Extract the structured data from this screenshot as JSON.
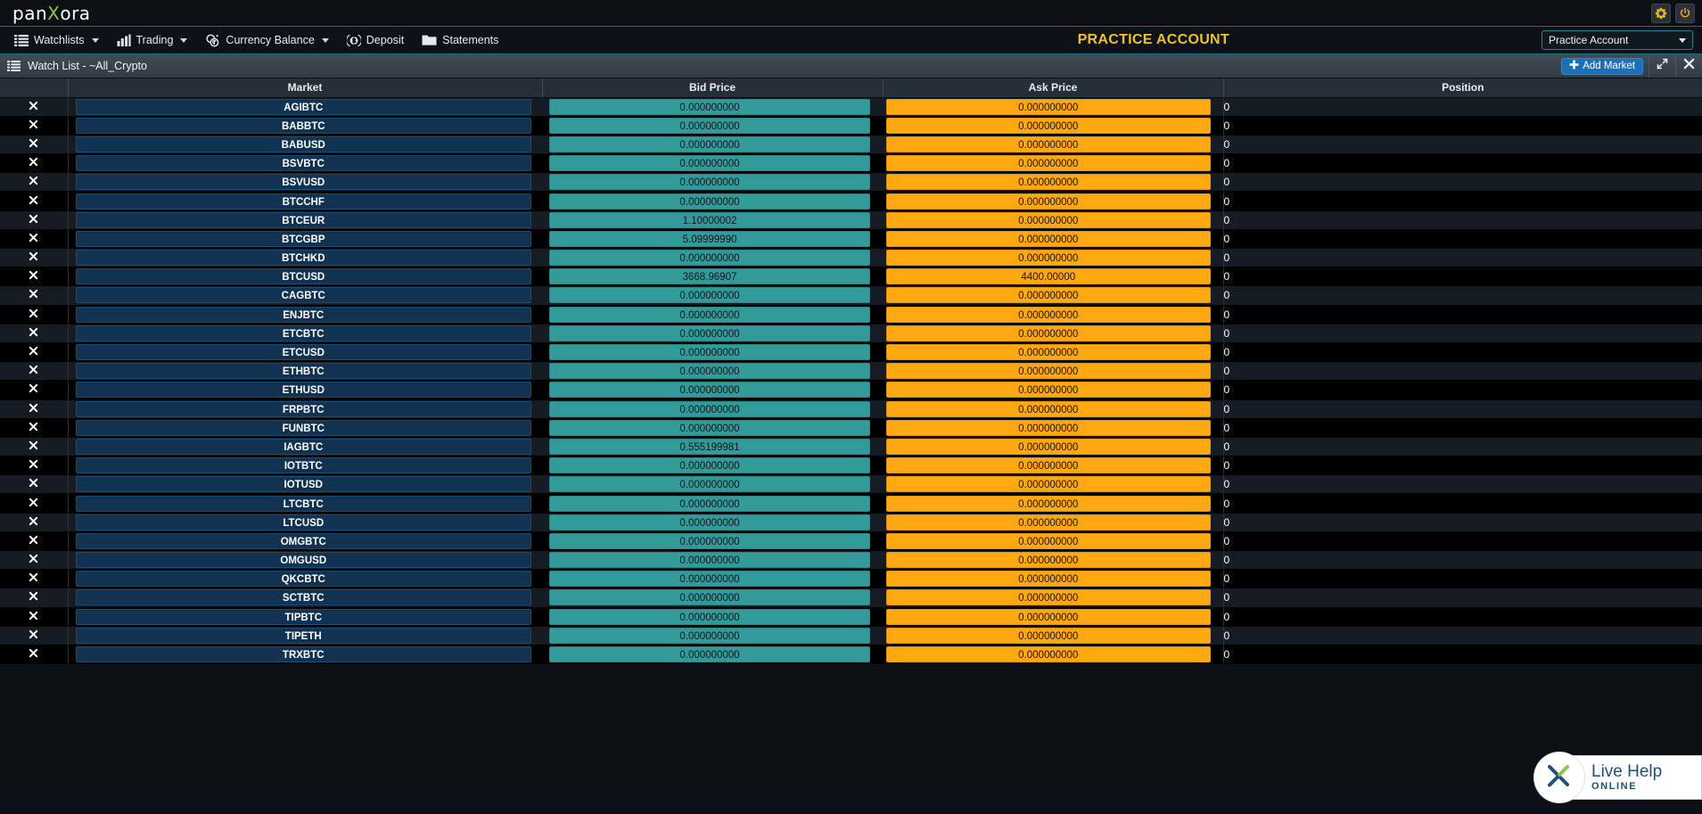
{
  "brand": {
    "name_pre": "pan",
    "name_x": "X",
    "name_post": "ora"
  },
  "topbar": {
    "settings_icon": "gear-icon",
    "power_icon": "power-icon"
  },
  "menubar": {
    "items": [
      {
        "label": "Watchlists",
        "icon": "list-icon",
        "caret": true
      },
      {
        "label": "Trading",
        "icon": "bar-chart-icon",
        "caret": true
      },
      {
        "label": "Currency Balance",
        "icon": "coins-icon",
        "caret": true
      },
      {
        "label": "Deposit",
        "icon": "bitcoin-icon",
        "caret": false
      },
      {
        "label": "Statements",
        "icon": "folder-icon",
        "caret": false
      }
    ],
    "practice_label": "PRACTICE ACCOUNT",
    "account_select": {
      "value": "Practice Account",
      "caret_icon": "chevron-down-icon"
    }
  },
  "panel": {
    "title": "Watch List - ~All_Crypto",
    "title_icon": "list-icon",
    "add_market_label": "Add Market",
    "add_market_icon": "plus-icon",
    "expand_icon": "expand-icon",
    "close_icon": "close-icon"
  },
  "table": {
    "columns": [
      "",
      "Market",
      "Bid Price",
      "Ask Price",
      "Position"
    ],
    "remove_icon": "close-icon",
    "rows": [
      {
        "market": "AGIBTC",
        "bid": "0.000000000",
        "ask": "0.000000000",
        "position": "0"
      },
      {
        "market": "BABBTC",
        "bid": "0.000000000",
        "ask": "0.000000000",
        "position": "0"
      },
      {
        "market": "BABUSD",
        "bid": "0.000000000",
        "ask": "0.000000000",
        "position": "0"
      },
      {
        "market": "BSVBTC",
        "bid": "0.000000000",
        "ask": "0.000000000",
        "position": "0"
      },
      {
        "market": "BSVUSD",
        "bid": "0.000000000",
        "ask": "0.000000000",
        "position": "0"
      },
      {
        "market": "BTCCHF",
        "bid": "0.000000000",
        "ask": "0.000000000",
        "position": "0"
      },
      {
        "market": "BTCEUR",
        "bid": "1.10000002",
        "ask": "0.000000000",
        "position": "0"
      },
      {
        "market": "BTCGBP",
        "bid": "5.09999990",
        "ask": "0.000000000",
        "position": "0"
      },
      {
        "market": "BTCHKD",
        "bid": "0.000000000",
        "ask": "0.000000000",
        "position": "0"
      },
      {
        "market": "BTCUSD",
        "bid": "3668.96907",
        "ask": "4400.00000",
        "position": "0"
      },
      {
        "market": "CAGBTC",
        "bid": "0.000000000",
        "ask": "0.000000000",
        "position": "0"
      },
      {
        "market": "ENJBTC",
        "bid": "0.000000000",
        "ask": "0.000000000",
        "position": "0"
      },
      {
        "market": "ETCBTC",
        "bid": "0.000000000",
        "ask": "0.000000000",
        "position": "0"
      },
      {
        "market": "ETCUSD",
        "bid": "0.000000000",
        "ask": "0.000000000",
        "position": "0"
      },
      {
        "market": "ETHBTC",
        "bid": "0.000000000",
        "ask": "0.000000000",
        "position": "0"
      },
      {
        "market": "ETHUSD",
        "bid": "0.000000000",
        "ask": "0.000000000",
        "position": "0"
      },
      {
        "market": "FRPBTC",
        "bid": "0.000000000",
        "ask": "0.000000000",
        "position": "0"
      },
      {
        "market": "FUNBTC",
        "bid": "0.000000000",
        "ask": "0.000000000",
        "position": "0"
      },
      {
        "market": "IAGBTC",
        "bid": "0.555199981",
        "ask": "0.000000000",
        "position": "0"
      },
      {
        "market": "IOTBTC",
        "bid": "0.000000000",
        "ask": "0.000000000",
        "position": "0"
      },
      {
        "market": "IOTUSD",
        "bid": "0.000000000",
        "ask": "0.000000000",
        "position": "0"
      },
      {
        "market": "LTCBTC",
        "bid": "0.000000000",
        "ask": "0.000000000",
        "position": "0"
      },
      {
        "market": "LTCUSD",
        "bid": "0.000000000",
        "ask": "0.000000000",
        "position": "0"
      },
      {
        "market": "OMGBTC",
        "bid": "0.000000000",
        "ask": "0.000000000",
        "position": "0"
      },
      {
        "market": "OMGUSD",
        "bid": "0.000000000",
        "ask": "0.000000000",
        "position": "0"
      },
      {
        "market": "QKCBTC",
        "bid": "0.000000000",
        "ask": "0.000000000",
        "position": "0"
      },
      {
        "market": "SCTBTC",
        "bid": "0.000000000",
        "ask": "0.000000000",
        "position": "0"
      },
      {
        "market": "TIPBTC",
        "bid": "0.000000000",
        "ask": "0.000000000",
        "position": "0"
      },
      {
        "market": "TIPETH",
        "bid": "0.000000000",
        "ask": "0.000000000",
        "position": "0"
      },
      {
        "market": "TRXBTC",
        "bid": "0.000000000",
        "ask": "0.000000000",
        "position": "0"
      }
    ]
  },
  "live_help": {
    "title": "Live Help",
    "subtitle": "ONLINE",
    "icon": "x-logo-icon"
  },
  "colors": {
    "bid": "#339a9a",
    "ask": "#ffa812",
    "market_pill": "#123252",
    "accent_yellow": "#f0c12b",
    "add_market_blue": "#1d6fb8",
    "brand_green": "#8cc63f"
  }
}
